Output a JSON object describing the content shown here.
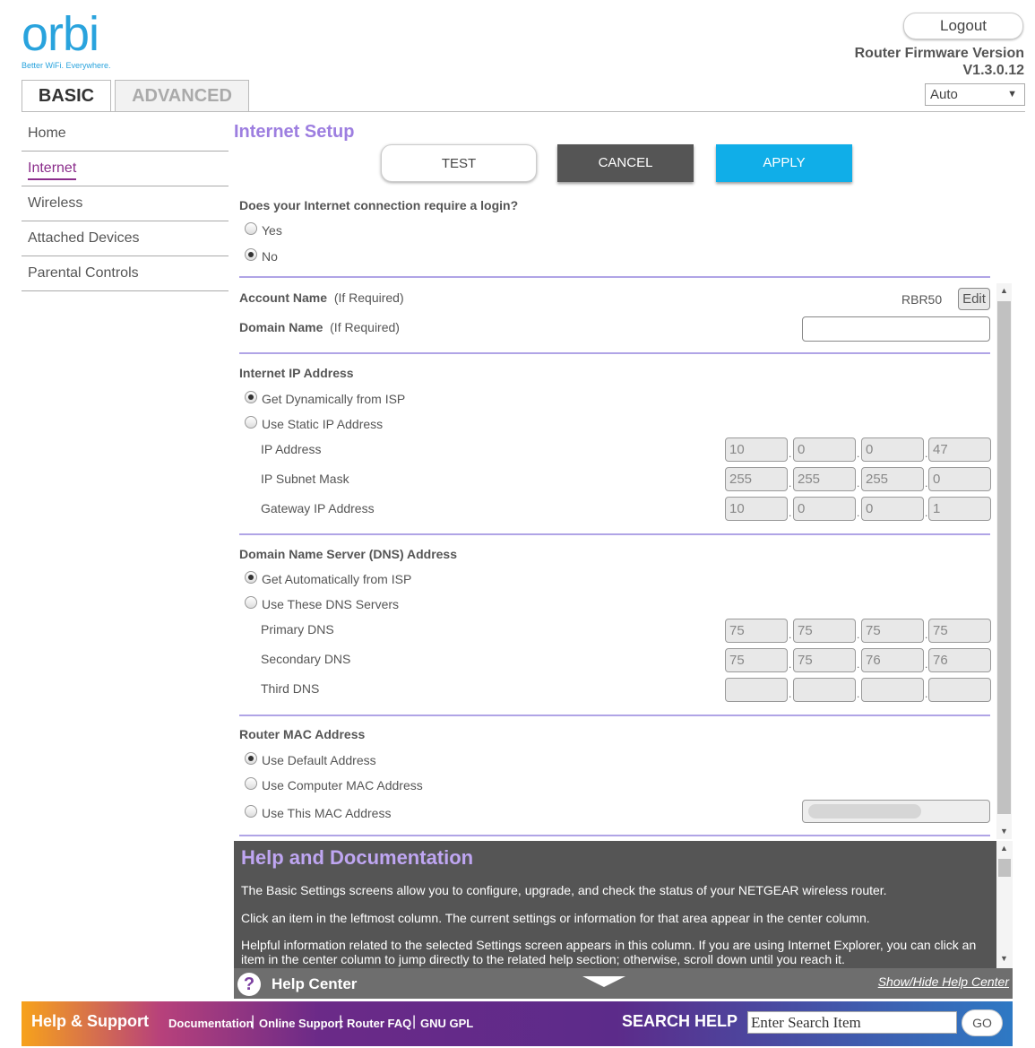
{
  "logo": {
    "word": "orbi",
    "tagline": "Better WiFi. Everywhere."
  },
  "header": {
    "logout": "Logout",
    "fw_label": "Router Firmware Version",
    "fw_version": "V1.3.0.12",
    "language": "Auto"
  },
  "tabs": {
    "basic": "BASIC",
    "advanced": "ADVANCED"
  },
  "sidebar": {
    "items": [
      {
        "label": "Home"
      },
      {
        "label": "Internet"
      },
      {
        "label": "Wireless"
      },
      {
        "label": "Attached Devices"
      },
      {
        "label": "Parental Controls"
      }
    ]
  },
  "page": {
    "title": "Internet Setup"
  },
  "buttons": {
    "test": "TEST",
    "cancel": "CANCEL",
    "apply": "APPLY"
  },
  "login": {
    "question": "Does your Internet connection require a login?",
    "yes": "Yes",
    "no": "No",
    "selected": "No"
  },
  "account": {
    "label": "Account Name",
    "hint": "(If Required)",
    "value": "RBR50",
    "edit": "Edit"
  },
  "domain": {
    "label": "Domain Name",
    "hint": "(If Required)",
    "value": ""
  },
  "ip_section": {
    "title": "Internet IP Address",
    "opt_dynamic": "Get Dynamically from ISP",
    "opt_static": "Use Static IP Address",
    "selected": "Get Dynamically from ISP",
    "ip_label": "IP Address",
    "ip": [
      "10",
      "0",
      "0",
      "47"
    ],
    "mask_label": "IP Subnet Mask",
    "mask": [
      "255",
      "255",
      "255",
      "0"
    ],
    "gw_label": "Gateway IP Address",
    "gw": [
      "10",
      "0",
      "0",
      "1"
    ]
  },
  "dns_section": {
    "title": "Domain Name Server (DNS) Address",
    "opt_auto": "Get Automatically from ISP",
    "opt_manual": "Use These DNS Servers",
    "selected": "Get Automatically from ISP",
    "primary_label": "Primary DNS",
    "primary": [
      "75",
      "75",
      "75",
      "75"
    ],
    "secondary_label": "Secondary DNS",
    "secondary": [
      "75",
      "75",
      "76",
      "76"
    ],
    "third_label": "Third DNS",
    "third": [
      "",
      "",
      "",
      ""
    ]
  },
  "mac_section": {
    "title": "Router MAC Address",
    "opt_default": "Use Default Address",
    "opt_computer": "Use Computer MAC Address",
    "opt_this": "Use This MAC Address",
    "selected": "Use Default Address"
  },
  "help": {
    "title": "Help and Documentation",
    "p1": "The Basic Settings screens allow you to configure, upgrade, and check the status of your NETGEAR wireless router.",
    "p2": "Click an item in the leftmost column. The current settings or information for that area appear in the center column.",
    "p3": "Helpful information related to the selected Settings screen appears in this column. If you are using Internet Explorer, you can click an item in the center column to jump directly to the related help section; otherwise, scroll down until you reach it."
  },
  "help_center": {
    "label": "Help Center",
    "toggle": "Show/Hide Help Center"
  },
  "footer": {
    "title": "Help & Support",
    "links": [
      "Documentation",
      "Online Support",
      "Router FAQ",
      "GNU GPL"
    ],
    "search_label": "SEARCH HELP",
    "search_value": "Enter Search Item",
    "go": "GO"
  },
  "colors": {
    "brand": "#29a3dd",
    "accent": "#9d7ee0",
    "apply": "#10aee8",
    "active_nav": "#8b2d8b"
  }
}
